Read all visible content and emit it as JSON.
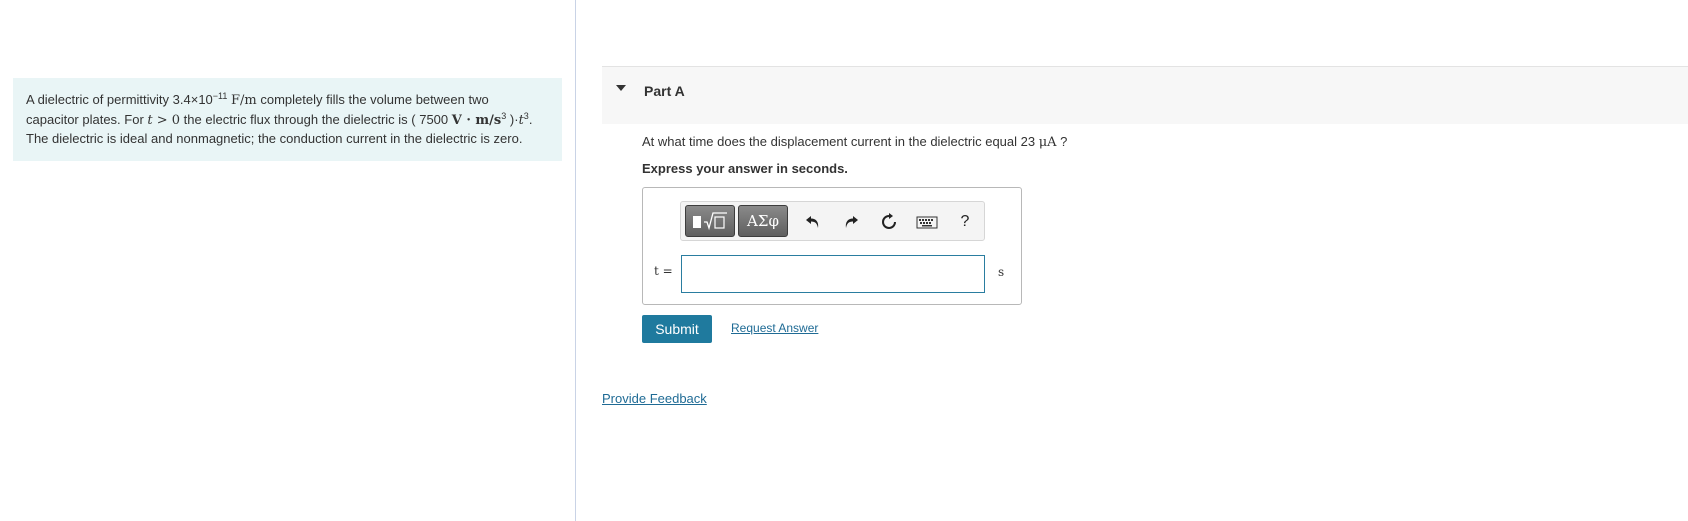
{
  "problem": {
    "t1": "A dielectric of permittivity 3.4×10",
    "exp_permittivity": "−11",
    "unit_permittivity": "F/m",
    "t2": " completely fills the volume between two",
    "t3": "capacitor plates. For ",
    "var_t": "t",
    "condition": " > 0",
    "t4": " the electric flux through the dielectric is ( 7500 ",
    "unit_flux": "V · m/s",
    "exp_unit": "3",
    "t5": " )·",
    "var_t2": "t",
    "exp_t": "3",
    "t6": ".",
    "t7": "The dielectric is ideal and nonmagnetic; the conduction current in the dielectric is zero."
  },
  "part": {
    "title": "Part A"
  },
  "question": {
    "text": "At what time does the displacement current in the dielectric equal 23 ",
    "unit": "μA",
    "end": " ?",
    "instruction": "Express your answer in seconds."
  },
  "toolbar": {
    "symbols_label": "ΑΣφ",
    "help_label": "?"
  },
  "answer": {
    "variable_label": "t =",
    "value": "",
    "unit": "s"
  },
  "actions": {
    "submit_label": "Submit",
    "request_answer_label": "Request Answer",
    "feedback_label": "Provide Feedback"
  },
  "icons": {
    "templates": "templates-icon",
    "undo": "undo-icon",
    "redo": "redo-icon",
    "reset": "reset-icon",
    "keyboard": "keyboard-icon",
    "help": "help-icon"
  },
  "colors": {
    "accent": "#1f7a9e",
    "link": "#1f6b95",
    "problem_bg": "#e9f5f6"
  }
}
